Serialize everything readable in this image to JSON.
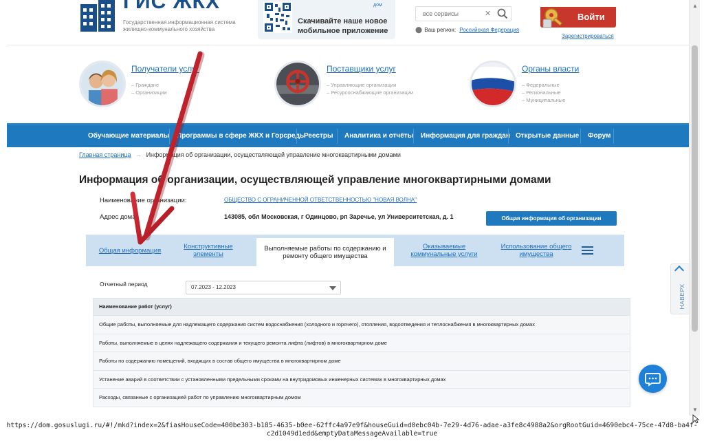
{
  "header": {
    "logo_title": "ГИС ЖКХ",
    "logo_subtitle": "Государственная информационная система жилищно-коммунального хозяйства",
    "app_banner_dom": "дом",
    "app_banner_text": "Скачивайте наше новое мобильное приложение",
    "search_placeholder": "все сервисы",
    "region_label": "Ваш регион:",
    "region_value": "Российская Федерация",
    "login_label": "Войти",
    "register_label": "Зарегистрироваться"
  },
  "categories": [
    {
      "title": "Получатели услуг",
      "items": [
        "– Граждане",
        "– Организации"
      ]
    },
    {
      "title": "Поставщики услуг",
      "items": [
        "– Управляющие организации",
        "– Ресурсоснабжающие организации"
      ]
    },
    {
      "title": "Органы власти",
      "items": [
        "– Федеральные",
        "– Региональные",
        "– Муниципальные"
      ]
    }
  ],
  "nav": {
    "items": [
      "Обучающие материалы",
      "Программы в сфере ЖКХ и Горсреды",
      "Реестры",
      "Аналитика и отчёты",
      "Информация для граждан",
      "Открытые данные",
      "Форум"
    ]
  },
  "breadcrumb": {
    "home": "Главная страница",
    "separator": "→",
    "current": "Информация об организации, осуществляющей управление многоквартирными домами"
  },
  "page": {
    "title": "Информация об организации, осуществляющей управление многоквартирными домами",
    "org_name_label": "Наименование организации:",
    "org_name_value": "ОБЩЕСТВО С ОГРАНИЧЕННОЙ ОТВЕТСТВЕННОСТЬЮ \"НОВАЯ ВОЛНА\"",
    "address_label": "Адрес дома:",
    "address_value": "143085, обл Московская, г Одинцово, рп Заречье, ул Университетская, д. 1",
    "org_button": "Общая информация об организации"
  },
  "tabs": [
    {
      "label": "Общая информация"
    },
    {
      "label": "Конструктивные элементы"
    },
    {
      "label": "Выполняемые работы по содержанию и ремонту общего имущества"
    },
    {
      "label": "Оказываемые коммунальные услуги"
    },
    {
      "label": "Использование общего имущества"
    }
  ],
  "period": {
    "label": "Отчетный период",
    "value": "07.2023 - 12.2023"
  },
  "works_table": {
    "header": "Наименование работ (услуг)",
    "rows": [
      "Общие работы, выполняемые для надлежащего содержания систем водоснабжения (холодного и горячего), отопления, водоотведения и теплоснабжения в многоквартирных домах",
      "Работы, выполняемые в целях надлежащего содержания и текущего ремонта лифта (лифтов) в многоквартирном доме",
      "Работы по содержанию помещений, входящих в состав общего имущества в многоквартирном доме",
      "Устанение аварий в соответствии с установленными предельными сроками на внутридомовых инженерных системах в многоквартирных домах",
      "Расходы, связанные с организацией работ по управлению многоквартирным домом"
    ]
  },
  "side_button": "НАВЕРХ",
  "status_url": "https://dom.gosuslugi.ru/#!/mkd?index=2&fiasHouseCode=400be303-b185-4635-b0ee-62ffc4a97e9f&houseGuid=d0ebc04b-7e29-4d76-adae-a3fe8c4988a2&orgRootGuid=4690ebc4-75ce-47d8-ba4f-c2d1049d1edd&emptyDataMessageAvailable=true",
  "colors": {
    "brand_blue": "#1f79bf",
    "link_blue": "#1e6fc1",
    "login_red": "#c8372c",
    "tab_bg": "#cce0f1",
    "annotation_arrow": "#c0202a"
  }
}
